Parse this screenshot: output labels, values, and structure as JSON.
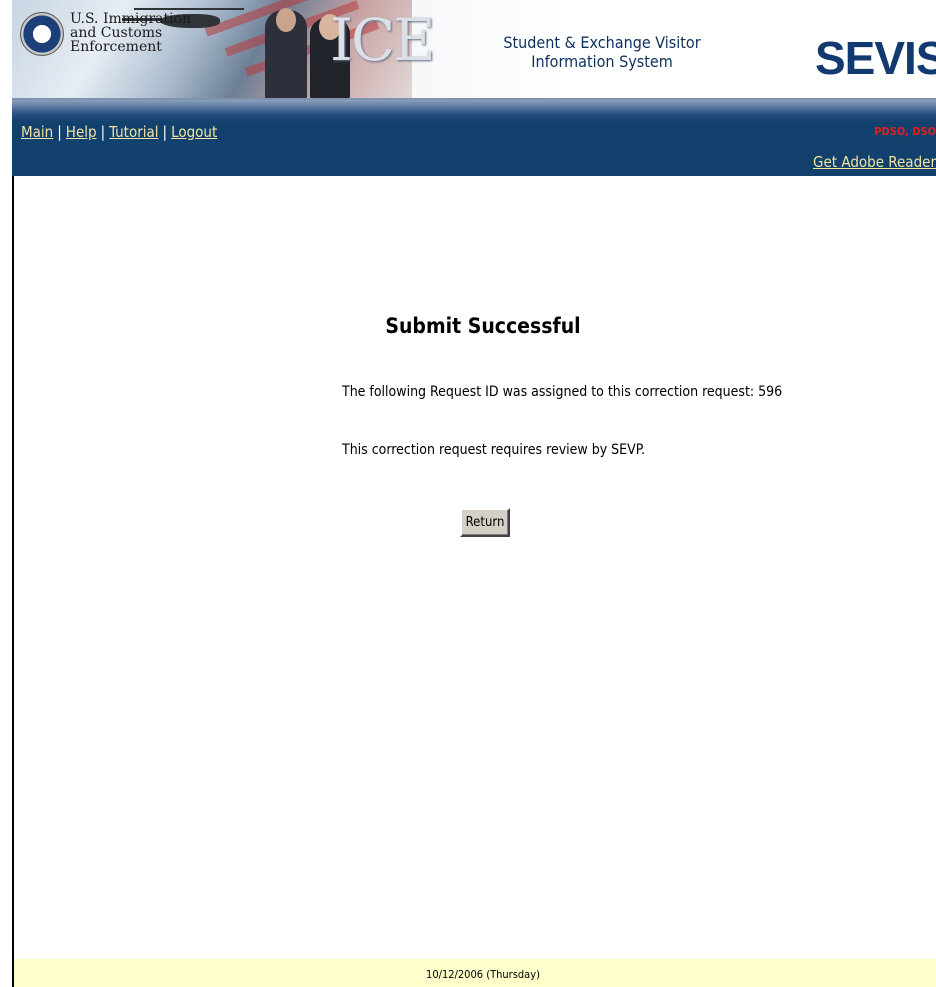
{
  "banner": {
    "agency_lines": [
      "U.S. Immigration",
      "and Customs",
      "Enforcement"
    ],
    "ice_logo_text": "ICE",
    "system_name_lines": [
      "Student & Exchange Visitor",
      "Information System"
    ],
    "sevis_logo_text": "SEVIS"
  },
  "nav": {
    "links": [
      "Main",
      "Help",
      "Tutorial",
      "Logout"
    ],
    "separator": "|",
    "user_role": "PDSO, DSO",
    "adobe_link": "Get Adobe Reader"
  },
  "main": {
    "title": "Submit Successful",
    "request_message": "The following Request ID was assigned to this correction request:  596",
    "review_message": "This correction request requires review by SEVP.",
    "return_label": "Return"
  },
  "footer": {
    "date": "10/12/2006 (Thursday)"
  },
  "colors": {
    "nav_background": "#13416e",
    "link_color": "#f0e4a0",
    "footer_background": "#ffffcc",
    "role_text": "#e02020",
    "sevis_logo": "#123a70"
  }
}
